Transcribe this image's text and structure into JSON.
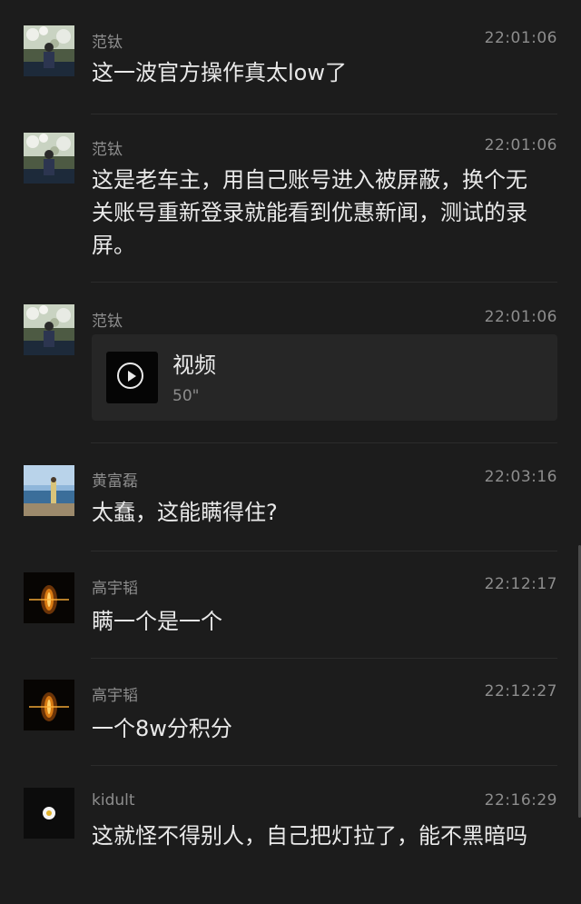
{
  "messages": [
    {
      "name": "范钛",
      "time": "22:01:06",
      "text": "这一波官方操作真太low了",
      "avatar_icon": "avatar-photo-flowers"
    },
    {
      "name": "范钛",
      "time": "22:01:06",
      "text": "这是老车主，用自己账号进入被屏蔽，换个无关账号重新登录就能看到优惠新闻，测试的录屏。",
      "avatar_icon": "avatar-photo-flowers"
    },
    {
      "name": "范钛",
      "time": "22:01:06",
      "video": {
        "title": "视频",
        "duration": "50\""
      },
      "avatar_icon": "avatar-photo-flowers"
    },
    {
      "name": "黄富磊",
      "time": "22:03:16",
      "text": "太蠢，这能瞒得住?",
      "avatar_icon": "avatar-photo-lake"
    },
    {
      "name": "高宇韬",
      "time": "22:12:17",
      "text": "瞒一个是一个",
      "avatar_icon": "avatar-fire-orb"
    },
    {
      "name": "高宇韬",
      "time": "22:12:27",
      "text": "一个8w分积分",
      "avatar_icon": "avatar-fire-orb"
    },
    {
      "name": "kidult",
      "time": "22:16:29",
      "text": "这就怪不得别人，自己把灯拉了，能不黑暗吗",
      "avatar_icon": "avatar-daisy"
    }
  ],
  "colors": {
    "background": "#1c1c1c",
    "text": "#e9e9e9",
    "meta": "#8d8d8d",
    "card": "#262626"
  }
}
